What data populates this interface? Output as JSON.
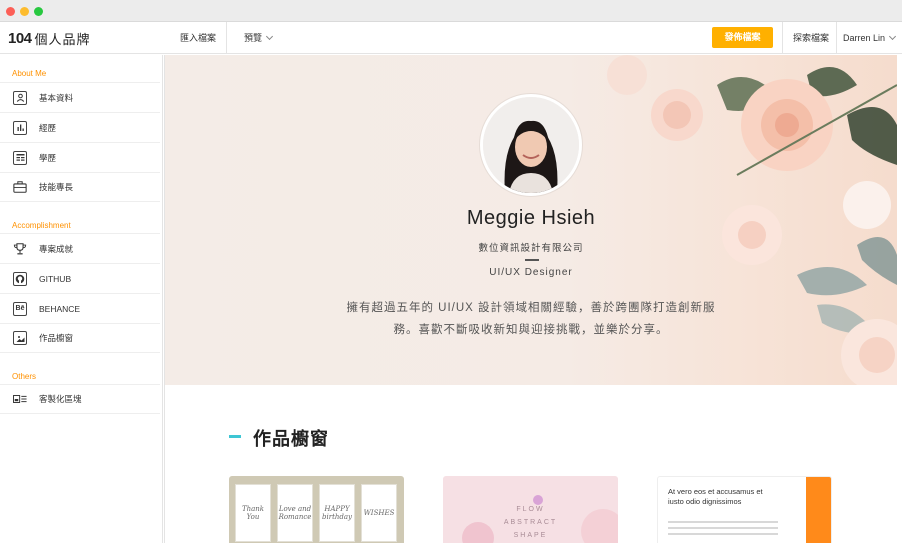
{
  "brand": {
    "logo_number": "104",
    "logo_text": "個人品牌"
  },
  "topnav": {
    "import_label": "匯入檔案",
    "preview_label": "預覽",
    "publish_label": "發佈檔案",
    "explore_label": "探索檔案",
    "user_name": "Darren Lin"
  },
  "sidebar": {
    "sections": [
      {
        "title": "About Me",
        "items": [
          {
            "label": "基本資料",
            "icon": "person-card-icon"
          },
          {
            "label": "經歷",
            "icon": "bar-chart-icon"
          },
          {
            "label": "學歷",
            "icon": "table-icon"
          },
          {
            "label": "技能專長",
            "icon": "briefcase-icon"
          }
        ]
      },
      {
        "title": "Accomplishment",
        "items": [
          {
            "label": "專案成就",
            "icon": "trophy-icon"
          },
          {
            "label": "GITHUB",
            "icon": "github-icon"
          },
          {
            "label": "BEHANCE",
            "icon": "behance-icon",
            "glyph": "Bē"
          },
          {
            "label": "作品櫥窗",
            "icon": "gallery-icon"
          }
        ]
      },
      {
        "title": "Others",
        "items": [
          {
            "label": "客製化區塊",
            "icon": "custom-block-icon"
          }
        ]
      }
    ]
  },
  "profile": {
    "name": "Meggie Hsieh",
    "company": "數位資訊設計有限公司",
    "role": "UI/UX Designer",
    "bio": "擁有超過五年的 UI/UX 設計領域相關經驗，善於跨團隊打造創新服務。喜歡不斷吸收新知與迎接挑戰，並樂於分享。"
  },
  "works": {
    "title": "作品櫥窗",
    "cards": [
      {
        "thumbs": [
          "Thank You",
          "Love and Romance",
          "HAPPY birthday",
          "WISHES"
        ]
      },
      {
        "lines": [
          "FLOW",
          "ABSTRACT",
          "SHAPE"
        ]
      },
      {
        "lines": [
          "At vero eos et accusamus et",
          "iusto odio dignissimos"
        ]
      }
    ]
  },
  "colors": {
    "accent": "#ffb000",
    "section_title": "#ff9100",
    "works_bar": "#3ec6d4"
  }
}
